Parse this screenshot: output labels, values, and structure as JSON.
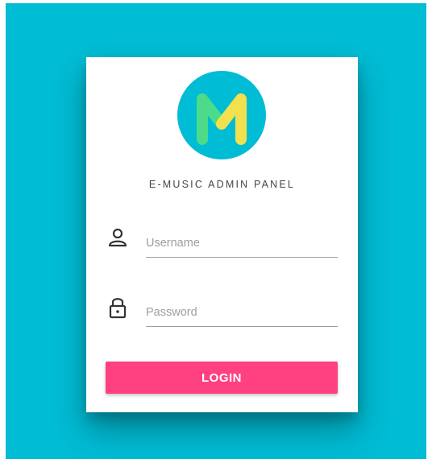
{
  "app": {
    "title": "E-MUSIC ADMIN PANEL",
    "logo_letter": "M"
  },
  "form": {
    "username": {
      "placeholder": "Username",
      "value": "",
      "icon": "user-icon"
    },
    "password": {
      "placeholder": "Password",
      "value": "",
      "icon": "lock-icon"
    },
    "login_label": "LOGIN"
  },
  "colors": {
    "background": "#00bcd4",
    "card": "#ffffff",
    "primary_button": "#ff4081",
    "logo_circle": "#00bcd4",
    "logo_green": "#4cdb8a",
    "logo_yellow": "#f2e14e"
  }
}
